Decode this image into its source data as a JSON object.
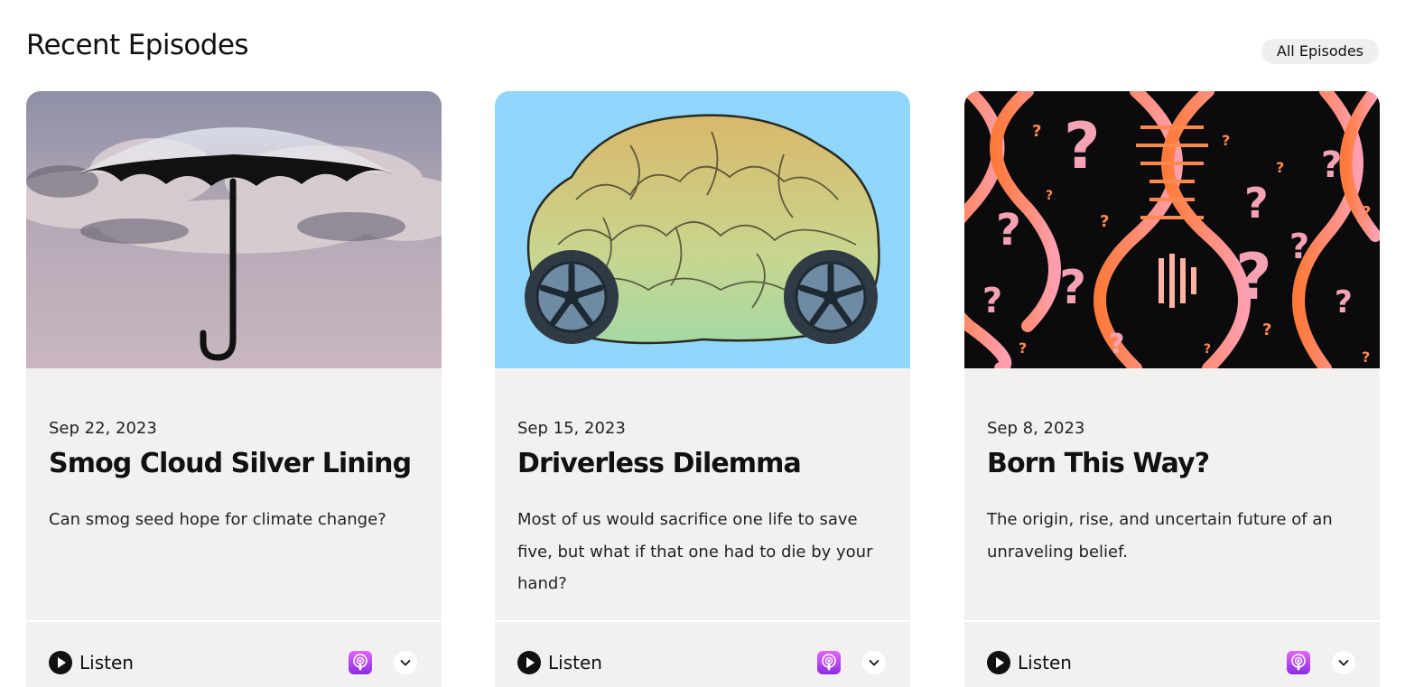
{
  "section": {
    "title": "Recent Episodes",
    "all_episodes_label": "All Episodes"
  },
  "episodes": [
    {
      "date": "Sep 22, 2023",
      "title": "Smog Cloud Silver Lining",
      "description": "Can smog seed hope for climate change?",
      "listen_label": "Listen",
      "art": "umbrella-clouds"
    },
    {
      "date": "Sep 15, 2023",
      "title": "Driverless Dilemma",
      "description": "Most of us would sacrifice one life to save five, but what if that one had to die by your hand?",
      "listen_label": "Listen",
      "art": "brain-on-wheels"
    },
    {
      "date": "Sep 8, 2023",
      "title": "Born This Way?",
      "description": "The origin, rise, and uncertain future of an unraveling belief.",
      "listen_label": "Listen",
      "art": "dna-question-marks"
    }
  ],
  "icons": {
    "play": "play-icon",
    "podcast": "apple-podcasts-icon",
    "expand": "chevron-down-icon"
  },
  "colors": {
    "card_bg": "#f2f1ef",
    "sky_blue": "#8fd6fa",
    "podcast_purple": "#b150e2",
    "dna_orange": "#ff8a4c"
  }
}
